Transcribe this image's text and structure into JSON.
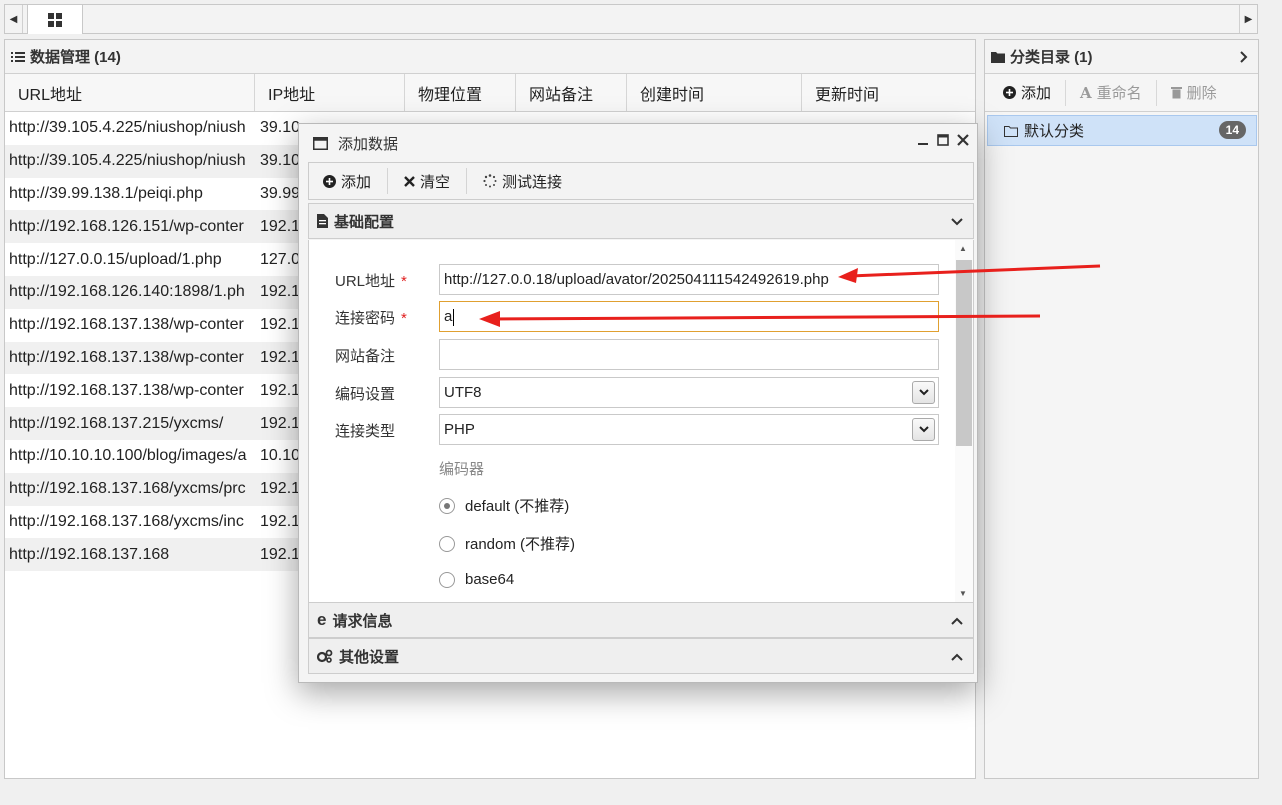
{
  "topbar": {
    "tab_icon": "grid-icon"
  },
  "data_panel": {
    "title": "数据管理 (14)",
    "columns": [
      "URL地址",
      "IP地址",
      "物理位置",
      "网站备注",
      "创建时间",
      "更新时间"
    ],
    "rows": [
      {
        "url": "http://39.105.4.225/niushop/niush",
        "ip": "39.10"
      },
      {
        "url": "http://39.105.4.225/niushop/niush",
        "ip": "39.10"
      },
      {
        "url": "http://39.99.138.1/peiqi.php",
        "ip": "39.99"
      },
      {
        "url": "http://192.168.126.151/wp-conter",
        "ip": "192.1"
      },
      {
        "url": "http://127.0.0.15/upload/1.php",
        "ip": "127.0"
      },
      {
        "url": "http://192.168.126.140:1898/1.ph",
        "ip": "192.1"
      },
      {
        "url": "http://192.168.137.138/wp-conter",
        "ip": "192.1"
      },
      {
        "url": "http://192.168.137.138/wp-conter",
        "ip": "192.1"
      },
      {
        "url": "http://192.168.137.138/wp-conter",
        "ip": "192.1"
      },
      {
        "url": "http://192.168.137.215/yxcms/",
        "ip": "192.1"
      },
      {
        "url": "http://10.10.10.100/blog/images/a",
        "ip": "10.10"
      },
      {
        "url": "http://192.168.137.168/yxcms/prc",
        "ip": "192.1"
      },
      {
        "url": "http://192.168.137.168/yxcms/inc",
        "ip": "192.1"
      },
      {
        "url": "http://192.168.137.168",
        "ip": "192.1"
      }
    ]
  },
  "category_panel": {
    "title": "分类目录 (1)",
    "add_label": "添加",
    "rename_label": "重命名",
    "delete_label": "删除",
    "items": [
      {
        "name": "默认分类",
        "count": "14"
      }
    ]
  },
  "dialog": {
    "title": "添加数据",
    "toolbar": {
      "add_label": "添加",
      "clear_label": "清空",
      "test_label": "测试连接"
    },
    "basic_section": "基础配置",
    "request_section": "请求信息",
    "other_section": "其他设置",
    "form": {
      "url_label": "URL地址",
      "url_value": "http://127.0.0.18/upload/avator/202504111542492619.php",
      "password_label": "连接密码",
      "password_value": "a",
      "note_label": "网站备注",
      "note_value": "",
      "encoding_label": "编码设置",
      "encoding_value": "UTF8",
      "type_label": "连接类型",
      "type_value": "PHP",
      "required_mark": "*",
      "encoder_label": "编码器",
      "encoders": [
        "default (不推荐)",
        "random (不推荐)",
        "base64"
      ]
    }
  },
  "colors": {
    "accent_selected": "#cfe2f8",
    "annotation_arrow": "#e8201c",
    "focus_border": "#e0a030"
  }
}
